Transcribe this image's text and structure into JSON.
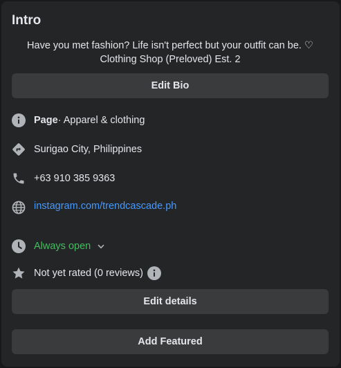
{
  "intro": {
    "title": "Intro",
    "bio_line1": "Have you met fashion? Life isn't perfect but your outfit can be. ♡",
    "bio_line2": "Clothing Shop (Preloved) Est. 2",
    "edit_bio_label": "Edit Bio"
  },
  "details": {
    "page_label": "Page",
    "page_category": " · Apparel & clothing",
    "location": "Surigao City, Philippines",
    "phone": "+63 910 385 9363",
    "website": "instagram.com/trendcascade.ph",
    "hours": "Always open",
    "rating": "Not yet rated (0 reviews)"
  },
  "actions": {
    "edit_details_label": "Edit details",
    "add_featured_label": "Add Featured"
  },
  "colors": {
    "card_bg": "#242526",
    "button_bg": "#3a3b3c",
    "link": "#4599ff",
    "open_green": "#45bd62",
    "icon_gray": "#b0b3b8"
  }
}
